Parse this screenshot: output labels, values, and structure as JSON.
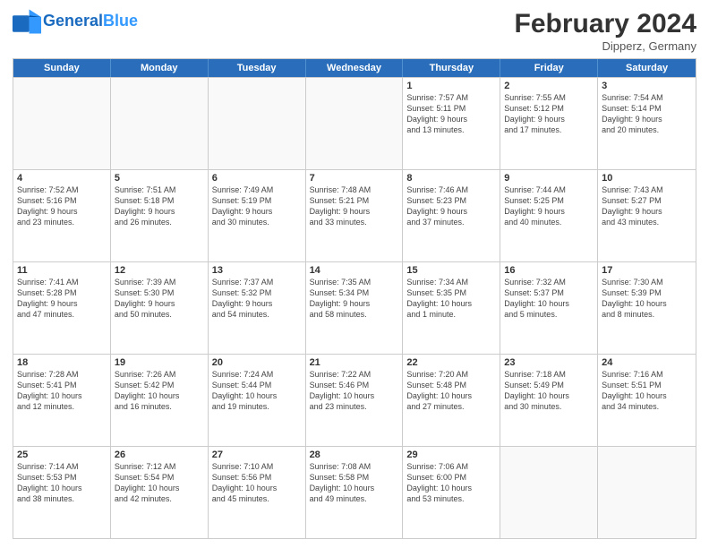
{
  "header": {
    "logo_general": "General",
    "logo_blue": "Blue",
    "title": "February 2024",
    "subtitle": "Dipperz, Germany"
  },
  "weekdays": [
    "Sunday",
    "Monday",
    "Tuesday",
    "Wednesday",
    "Thursday",
    "Friday",
    "Saturday"
  ],
  "rows": [
    [
      {
        "day": "",
        "info": ""
      },
      {
        "day": "",
        "info": ""
      },
      {
        "day": "",
        "info": ""
      },
      {
        "day": "",
        "info": ""
      },
      {
        "day": "1",
        "info": "Sunrise: 7:57 AM\nSunset: 5:11 PM\nDaylight: 9 hours\nand 13 minutes."
      },
      {
        "day": "2",
        "info": "Sunrise: 7:55 AM\nSunset: 5:12 PM\nDaylight: 9 hours\nand 17 minutes."
      },
      {
        "day": "3",
        "info": "Sunrise: 7:54 AM\nSunset: 5:14 PM\nDaylight: 9 hours\nand 20 minutes."
      }
    ],
    [
      {
        "day": "4",
        "info": "Sunrise: 7:52 AM\nSunset: 5:16 PM\nDaylight: 9 hours\nand 23 minutes."
      },
      {
        "day": "5",
        "info": "Sunrise: 7:51 AM\nSunset: 5:18 PM\nDaylight: 9 hours\nand 26 minutes."
      },
      {
        "day": "6",
        "info": "Sunrise: 7:49 AM\nSunset: 5:19 PM\nDaylight: 9 hours\nand 30 minutes."
      },
      {
        "day": "7",
        "info": "Sunrise: 7:48 AM\nSunset: 5:21 PM\nDaylight: 9 hours\nand 33 minutes."
      },
      {
        "day": "8",
        "info": "Sunrise: 7:46 AM\nSunset: 5:23 PM\nDaylight: 9 hours\nand 37 minutes."
      },
      {
        "day": "9",
        "info": "Sunrise: 7:44 AM\nSunset: 5:25 PM\nDaylight: 9 hours\nand 40 minutes."
      },
      {
        "day": "10",
        "info": "Sunrise: 7:43 AM\nSunset: 5:27 PM\nDaylight: 9 hours\nand 43 minutes."
      }
    ],
    [
      {
        "day": "11",
        "info": "Sunrise: 7:41 AM\nSunset: 5:28 PM\nDaylight: 9 hours\nand 47 minutes."
      },
      {
        "day": "12",
        "info": "Sunrise: 7:39 AM\nSunset: 5:30 PM\nDaylight: 9 hours\nand 50 minutes."
      },
      {
        "day": "13",
        "info": "Sunrise: 7:37 AM\nSunset: 5:32 PM\nDaylight: 9 hours\nand 54 minutes."
      },
      {
        "day": "14",
        "info": "Sunrise: 7:35 AM\nSunset: 5:34 PM\nDaylight: 9 hours\nand 58 minutes."
      },
      {
        "day": "15",
        "info": "Sunrise: 7:34 AM\nSunset: 5:35 PM\nDaylight: 10 hours\nand 1 minute."
      },
      {
        "day": "16",
        "info": "Sunrise: 7:32 AM\nSunset: 5:37 PM\nDaylight: 10 hours\nand 5 minutes."
      },
      {
        "day": "17",
        "info": "Sunrise: 7:30 AM\nSunset: 5:39 PM\nDaylight: 10 hours\nand 8 minutes."
      }
    ],
    [
      {
        "day": "18",
        "info": "Sunrise: 7:28 AM\nSunset: 5:41 PM\nDaylight: 10 hours\nand 12 minutes."
      },
      {
        "day": "19",
        "info": "Sunrise: 7:26 AM\nSunset: 5:42 PM\nDaylight: 10 hours\nand 16 minutes."
      },
      {
        "day": "20",
        "info": "Sunrise: 7:24 AM\nSunset: 5:44 PM\nDaylight: 10 hours\nand 19 minutes."
      },
      {
        "day": "21",
        "info": "Sunrise: 7:22 AM\nSunset: 5:46 PM\nDaylight: 10 hours\nand 23 minutes."
      },
      {
        "day": "22",
        "info": "Sunrise: 7:20 AM\nSunset: 5:48 PM\nDaylight: 10 hours\nand 27 minutes."
      },
      {
        "day": "23",
        "info": "Sunrise: 7:18 AM\nSunset: 5:49 PM\nDaylight: 10 hours\nand 30 minutes."
      },
      {
        "day": "24",
        "info": "Sunrise: 7:16 AM\nSunset: 5:51 PM\nDaylight: 10 hours\nand 34 minutes."
      }
    ],
    [
      {
        "day": "25",
        "info": "Sunrise: 7:14 AM\nSunset: 5:53 PM\nDaylight: 10 hours\nand 38 minutes."
      },
      {
        "day": "26",
        "info": "Sunrise: 7:12 AM\nSunset: 5:54 PM\nDaylight: 10 hours\nand 42 minutes."
      },
      {
        "day": "27",
        "info": "Sunrise: 7:10 AM\nSunset: 5:56 PM\nDaylight: 10 hours\nand 45 minutes."
      },
      {
        "day": "28",
        "info": "Sunrise: 7:08 AM\nSunset: 5:58 PM\nDaylight: 10 hours\nand 49 minutes."
      },
      {
        "day": "29",
        "info": "Sunrise: 7:06 AM\nSunset: 6:00 PM\nDaylight: 10 hours\nand 53 minutes."
      },
      {
        "day": "",
        "info": ""
      },
      {
        "day": "",
        "info": ""
      }
    ]
  ]
}
